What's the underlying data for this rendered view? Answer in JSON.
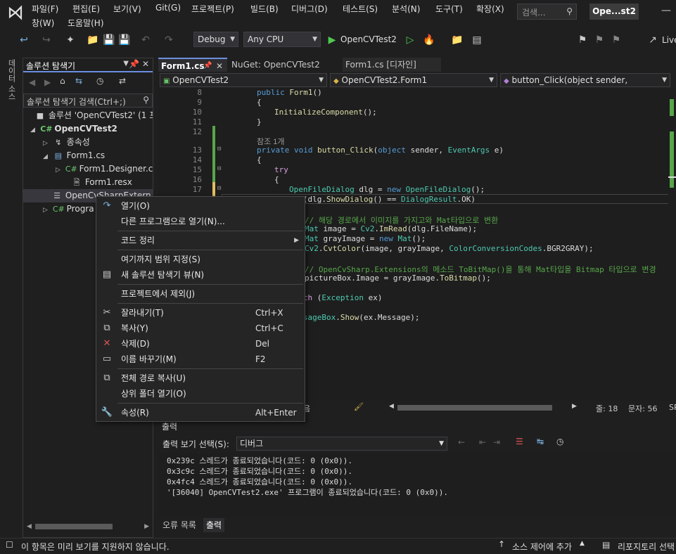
{
  "menu": {
    "items": [
      "파일(F)",
      "편집(E)",
      "보기(V)",
      "Git(G)",
      "프로젝트(P)",
      "빌드(B)",
      "디버그(D)",
      "테스트(S)",
      "분석(N)",
      "도구(T)",
      "확장(X)"
    ],
    "row2": [
      "창(W)",
      "도움말(H)"
    ],
    "search_placeholder": "검색...",
    "title": "Ope...st2"
  },
  "toolbar": {
    "config": "Debug",
    "platform": "Any CPU",
    "run_target": "OpenCVTest2",
    "live": "Live"
  },
  "vertical_tab": "데이터 소스",
  "solution_explorer": {
    "title": "솔루션 탐색기",
    "search": "솔루션 탐색기 검색(Ctrl+;)",
    "items": [
      {
        "label": "솔루션 'OpenCVTest2' (1 프",
        "icon": "solution-icon"
      },
      {
        "label": "OpenCVTest2",
        "icon": "csharp-project-icon"
      },
      {
        "label": "종속성",
        "icon": "dependencies-icon"
      },
      {
        "label": "Form1.cs",
        "icon": "form-icon"
      },
      {
        "label": "Form1.Designer.c",
        "icon": "csharp-file-icon"
      },
      {
        "label": "Form1.resx",
        "icon": "resx-icon"
      },
      {
        "label": "OpenCvSharpExtern",
        "icon": "library-icon"
      },
      {
        "label": "Progra",
        "icon": "csharp-file-icon"
      }
    ]
  },
  "editor": {
    "tabs": [
      "Form1.cs",
      "NuGet: OpenCVTest2",
      "Form1.cs [디자인]"
    ],
    "nav": [
      "OpenCVTest2",
      "OpenCVTest2.Form1",
      "button_Click(object sender, EventArgs"
    ],
    "line_numbers": [
      "8",
      "9",
      "10",
      "11",
      "12",
      "13",
      "14",
      "15",
      "16",
      "17"
    ],
    "references": "참조 1개",
    "status": {
      "zoom": "음",
      "line": "줄: 18",
      "col": "문자: 56",
      "extra": "SP"
    }
  },
  "output": {
    "title": "출력",
    "source_label": "출력 보기 선택(S):",
    "source_value": "디버그",
    "lines": [
      "0x239c 스레드가 종료되었습니다(코드: 0 (0x0)).",
      "0x3c9c 스레드가 종료되었습니다(코드: 0 (0x0)).",
      "0x4fc4 스레드가 종료되었습니다(코드: 0 (0x0)).",
      "'[36040] OpenCVTest2.exe' 프로그램이 종료되었습니다(코드: 0 (0x0))."
    ],
    "tabs": [
      "오류 목록",
      "출력"
    ]
  },
  "context_menu": {
    "items": [
      {
        "label": "열기(O)",
        "shortcut": "",
        "icon": "open-icon"
      },
      {
        "label": "다른 프로그램으로 열기(N)...",
        "shortcut": "",
        "icon": ""
      },
      {
        "label": "코드 정리",
        "shortcut": "",
        "icon": ""
      },
      {
        "label": "여기까지 범위 지정(S)",
        "shortcut": "",
        "icon": ""
      },
      {
        "label": "새 솔루션 탐색기 뷰(N)",
        "shortcut": "",
        "icon": "new-view-icon"
      },
      {
        "label": "프로젝트에서 제외(J)",
        "shortcut": "",
        "icon": ""
      },
      {
        "label": "잘라내기(T)",
        "shortcut": "Ctrl+X",
        "icon": "cut-icon"
      },
      {
        "label": "복사(Y)",
        "shortcut": "Ctrl+C",
        "icon": "copy-icon"
      },
      {
        "label": "삭제(D)",
        "shortcut": "Del",
        "icon": "delete-icon"
      },
      {
        "label": "이름 바꾸기(M)",
        "shortcut": "F2",
        "icon": "rename-icon"
      },
      {
        "label": "전체 경로 복사(U)",
        "shortcut": "",
        "icon": "copy-path-icon"
      },
      {
        "label": "상위 폴더 열기(O)",
        "shortcut": "",
        "icon": ""
      },
      {
        "label": "속성(R)",
        "shortcut": "Alt+Enter",
        "icon": "wrench-icon"
      }
    ]
  },
  "statusbar": {
    "message": "이 항목은 미리 보기를 지원하지 않습니다.",
    "source_control": "소스 제어에 추가",
    "repo": "리포지토리 선택"
  },
  "colors": {
    "accent": "#6c8fe0",
    "keyword": "#569cd6",
    "type": "#4ec9b0",
    "comment": "#57a64a",
    "run": "#4ec94e"
  }
}
